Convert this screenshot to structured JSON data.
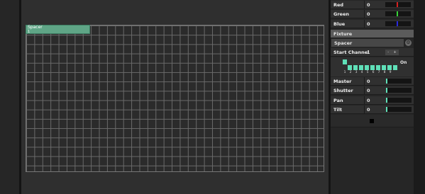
{
  "canvas": {
    "fixture": {
      "name": "Spacer",
      "address": "1"
    }
  },
  "color_rows": [
    {
      "label": "Red",
      "value": "0",
      "indicator_color": "#d62020"
    },
    {
      "label": "Green",
      "value": "0",
      "indicator_color": "#38d438"
    },
    {
      "label": "Blue",
      "value": "0",
      "indicator_color": "#2a2ae0"
    }
  ],
  "fixture_panel": {
    "header": "Fixture",
    "selected": "Spacer",
    "start_channel_label": "Start Channel",
    "start_channel_value": "1",
    "stepper_minus": "-",
    "stepper_plus": "+",
    "channels": [
      "1",
      "2",
      "3",
      "4",
      "5",
      "6",
      "7",
      "8",
      "9"
    ],
    "on_label": "On"
  },
  "param_rows": [
    {
      "label": "Master",
      "value": "0",
      "indicator_color": "#5fe0b8"
    },
    {
      "label": "Shutter",
      "value": "0",
      "indicator_color": "#5fe0b8"
    },
    {
      "label": "Pan",
      "value": "0",
      "indicator_color": "#5fe0b8"
    },
    {
      "label": "Tilt",
      "value": "0",
      "indicator_color": "#5fe0b8"
    }
  ]
}
